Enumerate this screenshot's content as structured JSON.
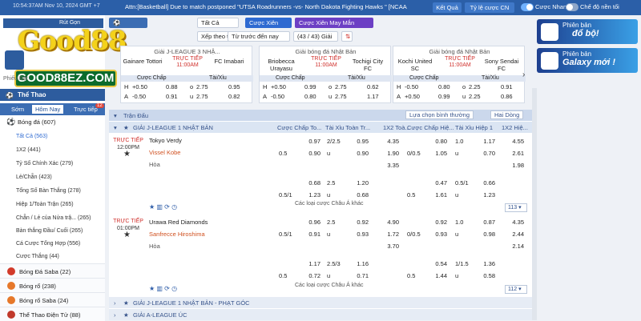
{
  "topbar": {
    "time": "10:54:37AM Nov 10, 2024 GMT +7",
    "ticker": "Attn:[Basketball] Due to match postponed \"UTSA Roadrunners -vs- North Dakota Fighting Hawks \" [NCAA",
    "result_btn": "Kết Quả",
    "odds_btn": "Tỷ lệ cược CN",
    "fast_bet": "Cược Nhanh",
    "night_mode": "Chế độ nền tối",
    "colors": {
      "bar": "#2b5fa8",
      "accent": "#2e6ad1"
    }
  },
  "logo": {
    "text": "Good88",
    "sub": "GOOD88EZ.COM"
  },
  "sidebar": {
    "withdraw": "Rút Gọn",
    "promo": "Phiếu Đặt",
    "sport_header": "Thể Thao",
    "tabs": [
      "Sớm",
      "Hôm Nay",
      "Trực tiếp"
    ],
    "live_badge": "12",
    "football": "Bóng đá (607)",
    "items": [
      "Tất Cả (563)",
      "1X2 (441)",
      "Tỷ Số Chính Xác (279)",
      "Lẻ/Chẵn (423)",
      "Tổng Số Bàn Thắng (278)",
      "Hiệp 1/Toàn Trận (265)",
      "Chẵn / Lẻ của Nửa trậ... (265)",
      "Bàn thắng Đầu/ Cuối (265)",
      "Cá Cược Tổng Hợp (556)",
      "Cược Thắng (44)"
    ],
    "sports": [
      "Bóng Đá Saba (22)",
      "Bóng rổ (238)",
      "Bóng rổ Saba (24)",
      "Thể Thao Điện Tử (88)"
    ]
  },
  "filters": {
    "all": "Tất Cả",
    "bet_slip": "Cược Xiên",
    "parlay": "Cược Xiên May Mắn",
    "sort": "Xếp theo trận đấu",
    "time": "Từ trước đến nay",
    "count": "(43 / 43) Giải",
    "tab1": "Trận Đấu",
    "market": "Lựa chọn bình thường",
    "double": "Hai Dòng"
  },
  "cards": [
    {
      "comp": "Giải J-LEAGUE 3 NHẬ...",
      "home": "Gainare Tottori",
      "status": "TRỰC TIẾP",
      "time": "11:00AM",
      "away": "FC Imabari",
      "h_hdp": "+0.50",
      "h_o": "0.88",
      "o_line": "2.75",
      "o_val": "0.95",
      "a_hdp": "-0.50",
      "a_o": "0.91",
      "u_line": "2.75",
      "u_val": "0.82"
    },
    {
      "comp": "Giải bóng đá Nhật Bản",
      "home": "Briobecca Urayasu",
      "status": "TRỰC TIẾP",
      "time": "11:00AM",
      "away": "Tochigi City FC",
      "h_hdp": "+0.50",
      "h_o": "0.99",
      "o_line": "2.75",
      "o_val": "0.62",
      "a_hdp": "-0.50",
      "a_o": "0.80",
      "u_line": "2.75",
      "u_val": "1.17"
    },
    {
      "comp": "Giải bóng đá Nhật Bản",
      "home": "Kochi United SC",
      "status": "TRỰC TIẾP",
      "time": "11:00AM",
      "away": "Sony Sendai FC",
      "h_hdp": "-0.50",
      "h_o": "0.80",
      "o_line": "2.25",
      "o_val": "0.91",
      "a_hdp": "+0.50",
      "a_o": "0.99",
      "u_line": "2.25",
      "u_val": "0.86"
    }
  ],
  "card_labels": {
    "hdp": "Cược Chấp",
    "ou": "Tài/Xỉu",
    "h": "H",
    "a": "A",
    "o": "o",
    "u": "u"
  },
  "ads": [
    {
      "line1": "Phiên bản",
      "line2": "đổ bộ!"
    },
    {
      "line1": "Phiên bản",
      "line2": "Galaxy mới !"
    }
  ],
  "grid": {
    "headers": [
      "Cược Chấp To...",
      "Tài Xỉu Toàn Tr...",
      "1X2 Toà...",
      "Cược Chấp Hiệ...",
      "Tài Xỉu Hiệp 1",
      "1X2 Hiệ..."
    ],
    "league1": "GIẢI J-LEAGUE 1 NHẬT BẢN",
    "league2": "GIẢI J-LEAGUE 1 NHẬT BẢN - PHẠT GÓC",
    "league3": "GIẢI A-LEAGUE ÚC",
    "m1": {
      "status": "TRỰC TIẾP",
      "time": "12:00PM",
      "home": "Tokyo Verdy",
      "away": "Vissel Kobe",
      "draw": "Hòa",
      "count": "113",
      "r1": [
        "",
        "0.97",
        "2/2.5",
        "0.95",
        "4.35",
        "",
        "0.80",
        "1.0",
        "1.17",
        "4.55"
      ],
      "r2": [
        "0.5",
        "0.90",
        "u",
        "0.90",
        "1.90",
        "0/0.5",
        "1.05",
        "u",
        "0.70",
        "2.61"
      ],
      "r3": [
        "",
        "",
        "",
        "",
        "3.35",
        "",
        "",
        "",
        "",
        "1.98"
      ],
      "r4": [
        "",
        "0.68",
        "2.5",
        "1.20",
        "",
        "",
        "0.47",
        "0.5/1",
        "0.66",
        ""
      ],
      "r5": [
        "0.5/1",
        "1.23",
        "u",
        "0.68",
        "",
        "0.5",
        "1.61",
        "u",
        "1.23",
        ""
      ]
    },
    "m2": {
      "status": "TRỰC TIẾP",
      "time": "01:00PM",
      "home": "Urawa Red Diamonds",
      "away": "Sanfrecce Hiroshima",
      "draw": "Hòa",
      "count": "112",
      "r1": [
        "",
        "0.96",
        "2.5",
        "0.92",
        "4.90",
        "",
        "0.92",
        "1.0",
        "0.87",
        "4.35"
      ],
      "r2": [
        "0.5/1",
        "0.91",
        "u",
        "0.93",
        "1.72",
        "0/0.5",
        "0.93",
        "u",
        "0.98",
        "2.44"
      ],
      "r3": [
        "",
        "",
        "",
        "",
        "3.70",
        "",
        "",
        "",
        "",
        "2.14"
      ],
      "r4": [
        "",
        "1.17",
        "2.5/3",
        "1.16",
        "",
        "",
        "0.54",
        "1/1.5",
        "1.36",
        ""
      ],
      "r5": [
        "0.5",
        "0.72",
        "u",
        "0.71",
        "",
        "0.5",
        "1.44",
        "u",
        "0.58",
        ""
      ]
    },
    "more": "Các loại cược Châu Á khác"
  }
}
